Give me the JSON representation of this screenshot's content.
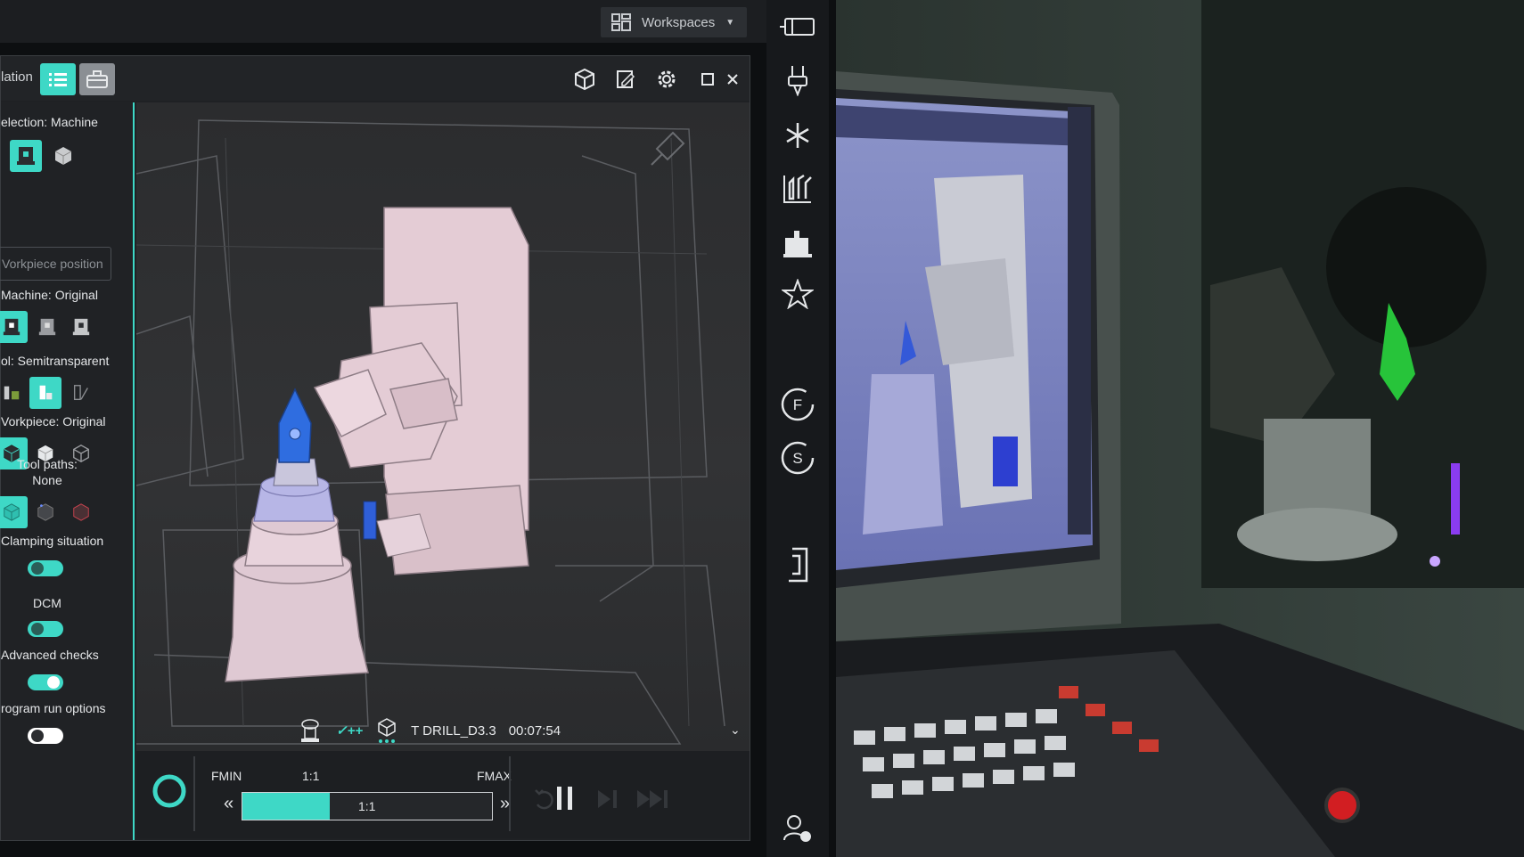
{
  "topbar": {
    "workspaces_label": "Workspaces"
  },
  "sim": {
    "title": "lation",
    "toolbar_icons": [
      "list-icon",
      "toolbox-icon",
      "cube-view-icon",
      "edit-note-icon",
      "gear-icon",
      "maximize-icon",
      "close-icon"
    ]
  },
  "left_panel": {
    "selection_label": "election: Machine",
    "workpiece_position_label": "Vorkpiece position",
    "machine_label": "Machine: Original",
    "tool_label": "ol: Semitransparent",
    "workpiece_label": "Vorkpiece: Original",
    "toolpaths_label": "Tool paths:",
    "toolpaths_value": "None",
    "clamping_label": "Clamping situation",
    "clamping_on": true,
    "dcm_label": "DCM",
    "dcm_on": true,
    "advanced_label": "Advanced checks",
    "advanced_on": true,
    "program_run_label": "rogram run options",
    "program_run_on": false
  },
  "status": {
    "check_label": "✓++",
    "tool_text": "T DRILL_D3.3",
    "time": "00:07:54"
  },
  "controls": {
    "fmin": "FMIN",
    "ratio_label": "1:1",
    "fmax": "FMAX",
    "slider_value": "1:1",
    "slider_fill_fraction": 0.35
  },
  "colors": {
    "accent": "#3ed8c6",
    "panel_bg": "#202225",
    "workpiece_blue": "#2f6de0",
    "machine_pink": "#e8cfd8"
  },
  "right_sidebar_icons": [
    "window-panel-icon",
    "tool-holder-icon",
    "snowflake-icon",
    "tool-table-icon",
    "machine-icon",
    "star-icon",
    "feed-override-icon",
    "spindle-override-icon",
    "program-icon",
    "user-icon"
  ],
  "feed_override_letter": "F",
  "spindle_override_letter": "S"
}
